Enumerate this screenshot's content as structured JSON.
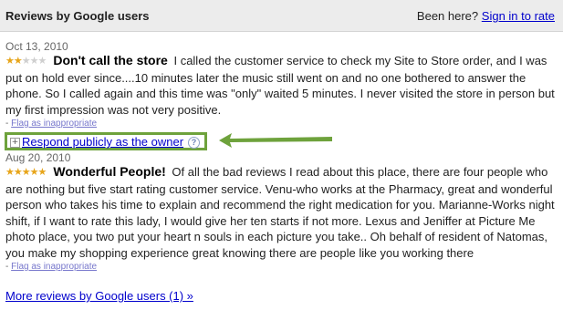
{
  "header": {
    "title": "Reviews by Google users",
    "prompt": "Been here?",
    "sign_in_label": "Sign in to rate"
  },
  "reviews": [
    {
      "date": "Oct 13, 2010",
      "rating": 2,
      "max_rating": 5,
      "title": "Don't call the store",
      "text": "I called the customer service to check my Site to Store order, and I was put on hold ever since....10 minutes later the music still went on and no one bothered to answer the phone. So I called again and this time was \"only\" waited 5 minutes. I never visited the store in person but my first impression was not very positive.",
      "flag_prefix": "-",
      "flag_label": "Flag as inappropriate",
      "respond_label": "Respond publicly as the owner",
      "help_label": "?"
    },
    {
      "date": "Aug 20, 2010",
      "rating": 5,
      "max_rating": 5,
      "title": "Wonderful People!",
      "text": "Of all the bad reviews I read about this place, there are four people who are nothing but five start rating customer service. Venu-who works at the Pharmacy, great and wonderful person who takes his time to explain and recommend the right medication for you. Marianne-Works night shift, if I want to rate this lady, I would give her ten starts if not more. Lexus and Jeniffer at Picture Me photo place, you two put your heart n souls in each picture you take.. Oh behalf of resident of Natomas, you make my shopping experience great knowing there are people like you working there",
      "flag_prefix": "-",
      "flag_label": "Flag as inappropriate"
    }
  ],
  "more_reviews_label": "More reviews by Google users (1) »",
  "colors": {
    "header_bg": "#ececec",
    "link": "#0000cc",
    "star_on": "#e7a51a",
    "star_off": "#cfcfcf",
    "highlight": "#6ea23c"
  },
  "icons": {
    "star": "★",
    "plus": "+",
    "help": "?"
  }
}
